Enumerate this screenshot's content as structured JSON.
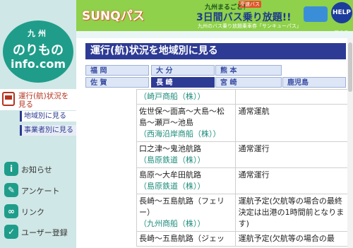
{
  "banner": {
    "logo_text": "SUNQパス",
    "tag": "高速バス",
    "line1": "九州まるごと！",
    "line2": "3日間バス乗り放題!!",
    "line3": "九州のバス乗り放題乗車券「サンキューパス」",
    "help": "HELP TOP"
  },
  "logo": {
    "line1": "九州",
    "line2": "のりもの",
    "line3": "info.com"
  },
  "sidebar": {
    "main_item": "運行(航)状況を見る",
    "sub_items": [
      "地域別に見る",
      "事業者別に見る"
    ],
    "items": [
      "お知らせ",
      "アンケート",
      "リンク",
      "ユーザー登録"
    ]
  },
  "heading": "運行(航)状況を地域別に見る",
  "regions": {
    "fukuoka": "福 岡",
    "oita": "大 分",
    "kumamoto": "熊 本",
    "saga": "佐 賀",
    "nagasaki": "長 崎",
    "miyazaki": "宮 崎",
    "kagoshima": "鹿児島"
  },
  "table": {
    "rows": [
      {
        "route": "",
        "operator": "（崎戸商船（株））",
        "status": ""
      },
      {
        "route": "佐世保〜面高〜大島〜松島〜瀬戸〜池島",
        "operator": "（西海沿岸商船（株））",
        "status": "通常運航"
      },
      {
        "route": "口之津〜鬼池航路",
        "operator": "（島原鉄道（株））",
        "status": "通常運行"
      },
      {
        "route": "島原〜大牟田航路",
        "operator": "（島原鉄道（株））",
        "status": "通常運行"
      },
      {
        "route": "長崎〜五島航路（フェリー）",
        "operator": "（九州商船（株））",
        "status": "運航予定(欠航等の場合の最終決定は出港の1時間前となります)"
      },
      {
        "route": "長崎〜五島航路（ジェッ",
        "operator": "",
        "status": "運航予定(欠航等の場合の最"
      }
    ]
  }
}
